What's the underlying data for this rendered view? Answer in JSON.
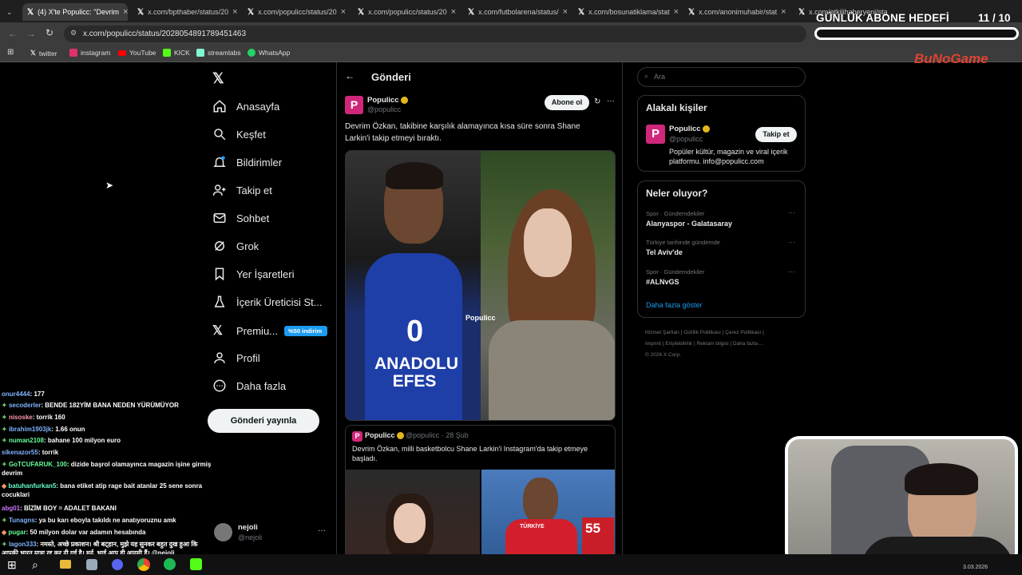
{
  "browser": {
    "tabs": [
      {
        "label": "(4) X'te Populicc: \"Devrim",
        "active": true
      },
      {
        "label": "x.com/bpthaber/status/20"
      },
      {
        "label": "x.com/populicc/status/20"
      },
      {
        "label": "x.com/populicc/status/20"
      },
      {
        "label": "x.com/futbolarena/status/"
      },
      {
        "label": "x.com/bosunatiklama/stat"
      },
      {
        "label": "x.com/anonimuhabir/stat"
      },
      {
        "label": "x.com/etkilihaberyeni/sta"
      }
    ],
    "url": "x.com/populicc/status/2028054891789451463",
    "bookmarks": [
      "twitter",
      "instagram",
      "YouTube",
      "KICK",
      "streamlabs",
      "WhatsApp"
    ]
  },
  "overlay": {
    "goal_title": "GÜNLÜK ABONE HEDEFİ",
    "goal_count": "11 / 10",
    "brand": "BuNoGame"
  },
  "sidebar": {
    "items": [
      "Anasayfa",
      "Keşfet",
      "Bildirimler",
      "Takip et",
      "Sohbet",
      "Grok",
      "Yer İşaretleri",
      "İçerik Üreticisi St...",
      "Premiu...",
      "Profil",
      "Daha fazla"
    ],
    "premium_badge": "%50 indirim",
    "post_button": "Gönderi yayınla",
    "account_name": "nejoli",
    "account_handle": "@nejoli"
  },
  "main": {
    "title": "Gönderi",
    "post": {
      "author": "Populicc",
      "handle": "@populicc",
      "follow_label": "Abone ol",
      "text": "Devrim Özkan, takibine karşılık alamayınca kısa süre sonra Shane Larkin'i takip etmeyi bıraktı.",
      "jersey_text": "ANADOLU EFES",
      "jersey_number": "0",
      "watermark": "Populicc"
    },
    "quote": {
      "author": "Populicc",
      "handle": "@populicc",
      "date": "· 28 Şub",
      "text": "Devrim Özkan, milli basketbolcu Shane Larkin'i Instagram'da takip etmeye başladı.",
      "jersey_text": "TÜRKİYE",
      "jersey_number": "55"
    }
  },
  "right": {
    "search_placeholder": "Ara",
    "related_title": "Alakalı kişiler",
    "related_name": "Populicc",
    "related_handle": "@populicc",
    "related_follow": "Takip et",
    "related_bio": "Popüler kültür, magazin ve viral içerik platformu. info@populicc.com",
    "trends_title": "Neler oluyor?",
    "trends": [
      {
        "category": "Spor · Gündemdekiler",
        "title": "Alanyaspor - Galatasaray"
      },
      {
        "category": "Türkiye tarihinde gündemde",
        "title": "Tel Aviv'de"
      },
      {
        "category": "Spor · Gündemdekiler",
        "title": "#ALNvGS"
      }
    ],
    "show_more": "Daha fazla göster",
    "footer_links": [
      "Hizmet Şartları",
      "Gizlilik Politikası",
      "Çerez Politikası",
      "Imprint",
      "Erişilebilirlik",
      "Reklam bilgisi",
      "Daha fazla ...",
      "© 2026 X Corp."
    ]
  },
  "chat": [
    {
      "user": "onur4444",
      "msg": ": 177"
    },
    {
      "user": "secoderler",
      "msg": ": BENDE 182YİM BANA NEDEN YÜRÜMÜYOR"
    },
    {
      "user": "nisoske",
      "msg": ": torrik 160"
    },
    {
      "user": "ibrahim1903jk",
      "msg": ": 1.66 onun"
    },
    {
      "user": "numan2108",
      "msg": ": bahane 100 milyon euro"
    },
    {
      "user": "sikenazor55",
      "msg": ": torrik"
    },
    {
      "user": "GoTCUFARUK_100",
      "msg": ": dizide başrol olamayınca magazin işine girmiş devrim"
    },
    {
      "user": "batuhanfurkan5",
      "msg": ": bana etiket atip rage bait atanlar 25 sene sonra cocuklari"
    },
    {
      "user": "abg01",
      "msg": ": BİZİM BOY = ADALET BAKANI"
    },
    {
      "user": "Tunagns",
      "msg": ": ya bu karı eboyla takıldı ne anatıyoruznu amk"
    },
    {
      "user": "pugar",
      "msg": ": 50 milyon dolar var adamın hesabında"
    },
    {
      "user": "lagon333",
      "msg": ": नमस्ते, अच्छे प्रकाशन। श्री बट्हान, मुझे यह सुनकर बहुत दुख हुआ कि आपकी भारत यात्रा रद्द कर दी गई है। मर्द, भाई आप ही आदमी हैं। @nejoli"
    }
  ],
  "taskbar": {
    "date": "3.03.2026"
  },
  "colors": {
    "x_blue": "#1d9bf0",
    "brand_pink": "#d0277b",
    "verified_gold": "#e2b719"
  }
}
